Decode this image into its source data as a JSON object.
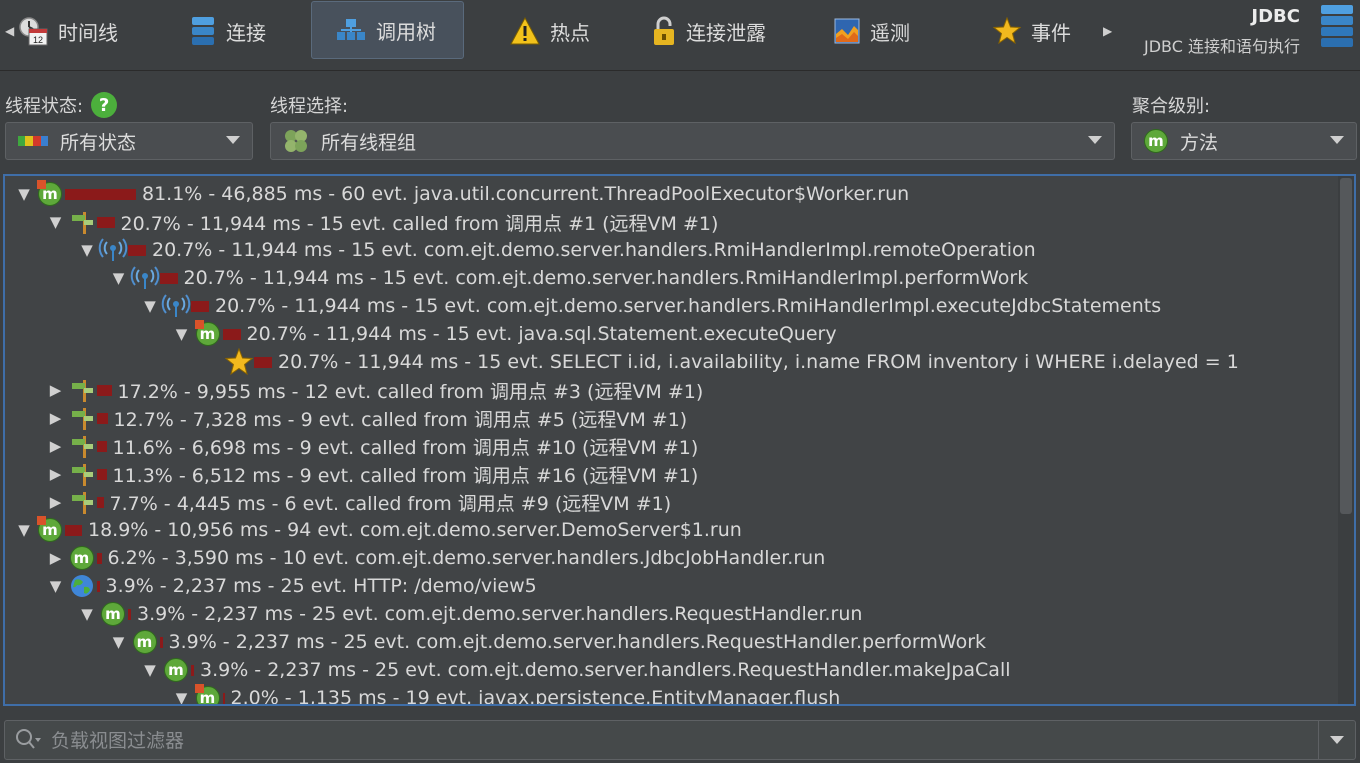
{
  "toolbar": {
    "tabs": [
      {
        "label": "时间线",
        "icon": "timeline-icon"
      },
      {
        "label": "连接",
        "icon": "connections-icon"
      },
      {
        "label": "调用树",
        "icon": "call-tree-icon"
      },
      {
        "label": "热点",
        "icon": "hotspots-icon"
      },
      {
        "label": "连接泄露",
        "icon": "connection-leaks-icon"
      },
      {
        "label": "遥测",
        "icon": "telemetry-icon"
      },
      {
        "label": "事件",
        "icon": "events-icon"
      }
    ],
    "active_tab": "调用树",
    "calendar_day": "12",
    "title": "JDBC",
    "subtitle": "JDBC 连接和语句执行"
  },
  "filters": {
    "thread_status_label": "线程状态:",
    "thread_status_value": "所有状态",
    "thread_select_label": "线程选择:",
    "thread_select_value": "所有线程组",
    "aggregation_label": "聚合级别:",
    "aggregation_value": "方法",
    "aggregation_icon_letter": "m"
  },
  "tree": {
    "rows": [
      {
        "text": "81.1% - 46,885 ms - 60 evt. java.util.concurrent.ThreadPoolExecutor$Worker.run",
        "icon": "thread-method",
        "toggle": "expanded",
        "pct": 81.1
      },
      {
        "text": "20.7% - 11,944 ms - 15 evt. called from 调用点 #1 (远程VM #1)",
        "icon": "signpost",
        "toggle": "expanded",
        "pct": 20.7
      },
      {
        "text": "20.7% - 11,944 ms - 15 evt. com.ejt.demo.server.handlers.RmiHandlerImpl.remoteOperation",
        "icon": "rmi",
        "toggle": "expanded",
        "pct": 20.7
      },
      {
        "text": "20.7% - 11,944 ms - 15 evt. com.ejt.demo.server.handlers.RmiHandlerImpl.performWork",
        "icon": "rmi",
        "toggle": "expanded",
        "pct": 20.7
      },
      {
        "text": "20.7% - 11,944 ms - 15 evt. com.ejt.demo.server.handlers.RmiHandlerImpl.executeJdbcStatements",
        "icon": "rmi",
        "toggle": "expanded",
        "pct": 20.7
      },
      {
        "text": "20.7% - 11,944 ms - 15 evt. java.sql.Statement.executeQuery",
        "icon": "thread-method",
        "toggle": "expanded",
        "pct": 20.7
      },
      {
        "text": "20.7% - 11,944 ms - 15 evt. SELECT i.id, i.availability, i.name FROM inventory i WHERE i.delayed = 1",
        "icon": "star",
        "toggle": "none",
        "pct": 20.7
      },
      {
        "text": "17.2% - 9,955 ms - 12 evt. called from 调用点 #3 (远程VM #1)",
        "icon": "signpost",
        "toggle": "collapsed",
        "pct": 17.2
      },
      {
        "text": "12.7% - 7,328 ms - 9 evt. called from 调用点 #5 (远程VM #1)",
        "icon": "signpost",
        "toggle": "collapsed",
        "pct": 12.7
      },
      {
        "text": "11.6% - 6,698 ms - 9 evt. called from 调用点 #10 (远程VM #1)",
        "icon": "signpost",
        "toggle": "collapsed",
        "pct": 11.6
      },
      {
        "text": "11.3% - 6,512 ms - 9 evt. called from 调用点 #16 (远程VM #1)",
        "icon": "signpost",
        "toggle": "collapsed",
        "pct": 11.3
      },
      {
        "text": "7.7% - 4,445 ms - 6 evt. called from 调用点 #9 (远程VM #1)",
        "icon": "signpost",
        "toggle": "collapsed",
        "pct": 7.7
      },
      {
        "text": "18.9% - 10,956 ms - 94 evt. com.ejt.demo.server.DemoServer$1.run",
        "icon": "thread-method",
        "toggle": "expanded",
        "pct": 18.9
      },
      {
        "text": "6.2% - 3,590 ms - 10 evt. com.ejt.demo.server.handlers.JdbcJobHandler.run",
        "icon": "method",
        "toggle": "collapsed",
        "pct": 6.2
      },
      {
        "text": "3.9% - 2,237 ms - 25 evt. HTTP: /demo/view5",
        "icon": "globe",
        "toggle": "expanded",
        "pct": 3.9
      },
      {
        "text": "3.9% - 2,237 ms - 25 evt. com.ejt.demo.server.handlers.RequestHandler.run",
        "icon": "method",
        "toggle": "expanded",
        "pct": 3.9
      },
      {
        "text": "3.9% - 2,237 ms - 25 evt. com.ejt.demo.server.handlers.RequestHandler.performWork",
        "icon": "method",
        "toggle": "expanded",
        "pct": 3.9
      },
      {
        "text": "3.9% - 2,237 ms - 25 evt. com.ejt.demo.server.handlers.RequestHandler.makeJpaCall",
        "icon": "method",
        "toggle": "expanded",
        "pct": 3.9
      },
      {
        "text": "2.0% - 1,135 ms - 19 evt. javax.persistence.EntityManager.flush",
        "icon": "thread-method",
        "toggle": "expanded",
        "pct": 2.0
      }
    ]
  },
  "bottom_filter": {
    "placeholder": "负载视图过滤器"
  },
  "colors": {
    "accent": "#3f6ea8",
    "bar": "#8b1a1a",
    "method_green": "#5ea83a"
  }
}
